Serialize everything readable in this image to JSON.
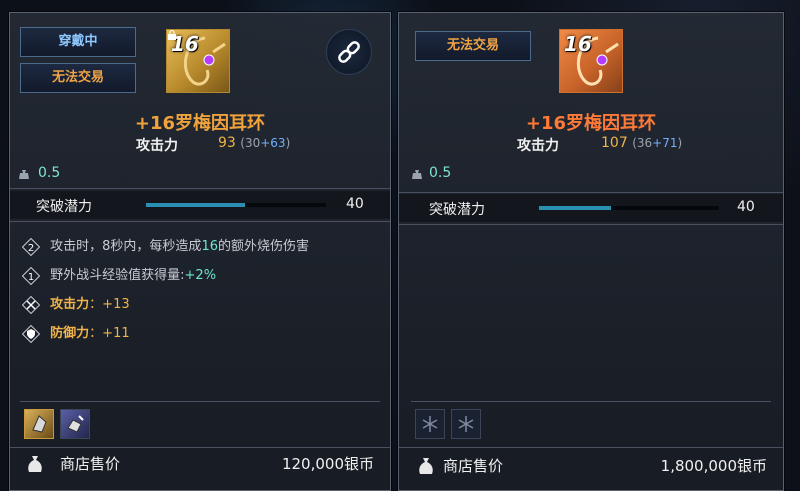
{
  "left": {
    "tags": [
      "穿戴中",
      "无法交易"
    ],
    "item": {
      "level": "16",
      "name": "+16罗梅因耳环"
    },
    "attack": {
      "label": "攻击力",
      "total": "93",
      "base": "(30",
      "bonus": "+63",
      "close": ")"
    },
    "weight": "0.5",
    "potential": {
      "label": "突破潜力",
      "value": "40",
      "fill": 0.55
    },
    "effects": [
      {
        "badge": "2",
        "pre": "攻击时，",
        "mid1": "8秒内，每秒造成",
        "num": "16",
        "post": "的额外烧伤伤害"
      },
      {
        "badge": "1",
        "pre": "野外战斗经验值获得量:",
        "num": "+2%"
      },
      {
        "label": "攻击力",
        "value": "+13"
      },
      {
        "label": "防御力",
        "value": "+11"
      }
    ],
    "price": {
      "label": "商店售价",
      "value": "120,000银币"
    }
  },
  "right": {
    "tags": [
      "无法交易"
    ],
    "item": {
      "level": "16",
      "name": "+16罗梅因耳环"
    },
    "attack": {
      "label": "攻击力",
      "total": "107",
      "base": "(36",
      "bonus": "+71",
      "close": ")"
    },
    "weight": "0.5",
    "potential": {
      "label": "突破潜力",
      "value": "40",
      "fill": 0.4
    },
    "price": {
      "label": "商店售价",
      "value": "1,800,000银币"
    }
  },
  "colors": {
    "accent_gold": "#f0a23c",
    "accent_orange": "#ff7a38",
    "bar": "#2b8fb4",
    "highlight": "#6fe6d0"
  },
  "icons": [
    "earring-icon",
    "link-icon",
    "lock-icon",
    "weight-icon",
    "money-bag-icon",
    "crystal-icon",
    "snowflake-slot-icon"
  ]
}
